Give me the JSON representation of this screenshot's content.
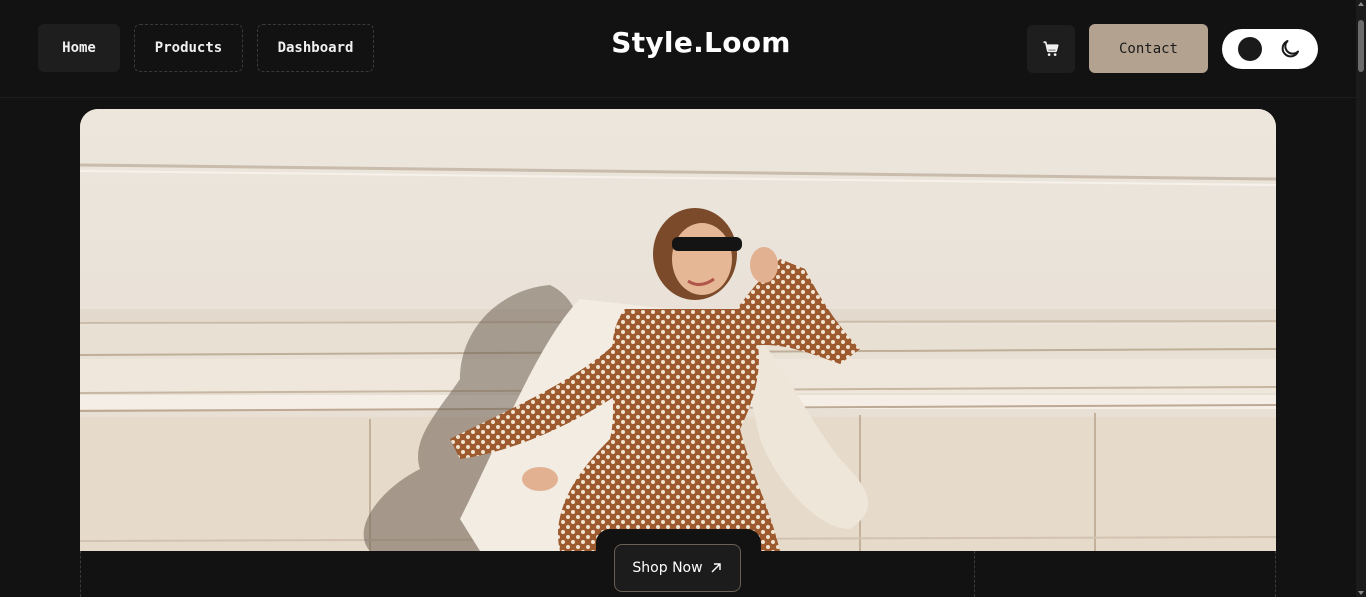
{
  "header": {
    "nav": [
      {
        "label": "Home"
      },
      {
        "label": "Products"
      },
      {
        "label": "Dashboard"
      }
    ],
    "brand": "Style.Loom",
    "cart_icon": "cart-icon",
    "contact_label": "Contact",
    "theme_toggle": {
      "state": "dark",
      "icon": "moon-icon"
    }
  },
  "hero": {
    "image_description": "photo-hero",
    "cta_label": "Shop Now",
    "cta_icon": "arrow-up-right-icon"
  },
  "colors": {
    "background": "#121212",
    "accent": "#b3a28f",
    "surface": "#1e1e1e"
  }
}
